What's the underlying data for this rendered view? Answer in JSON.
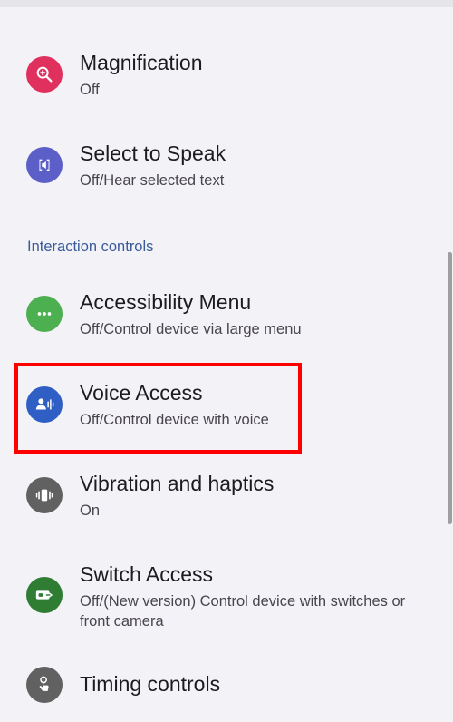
{
  "sections": {
    "interaction_controls": "Interaction controls"
  },
  "items": {
    "magnification": {
      "title": "Magnification",
      "subtitle": "Off",
      "color": "#e0305e"
    },
    "select_to_speak": {
      "title": "Select to Speak",
      "subtitle": "Off/Hear selected text",
      "color": "#5b5fc7"
    },
    "accessibility_menu": {
      "title": "Accessibility Menu",
      "subtitle": "Off/Control device via large menu",
      "color": "#4caf50"
    },
    "voice_access": {
      "title": "Voice Access",
      "subtitle": "Off/Control device with voice",
      "color": "#2f5fc4"
    },
    "vibration": {
      "title": "Vibration and haptics",
      "subtitle": "On",
      "color": "#616161"
    },
    "switch_access": {
      "title": "Switch Access",
      "subtitle": "Off/(New version) Control device with switches or front camera",
      "color": "#2e7d32"
    },
    "timing_controls": {
      "title": "Timing controls",
      "color": "#616161"
    }
  },
  "icons": {
    "magnification": "magnify-plus-icon",
    "select_to_speak": "speaker-icon",
    "accessibility_menu": "menu-dots-icon",
    "voice_access": "voice-person-icon",
    "vibration": "vibration-icon",
    "switch_access": "switch-icon",
    "timing_controls": "touch-hand-icon"
  }
}
